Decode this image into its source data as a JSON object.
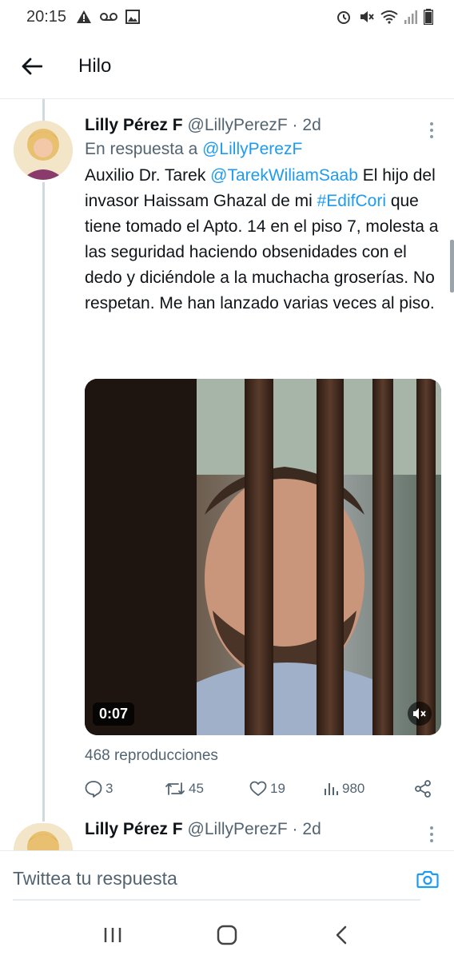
{
  "status_bar": {
    "time": "20:15",
    "left_icons": [
      "warning-icon",
      "voicemail-icon",
      "image-icon"
    ],
    "right_icons": [
      "alarm-icon",
      "mute-icon",
      "wifi-icon",
      "signal-icon",
      "battery-icon"
    ]
  },
  "header": {
    "title": "Hilo",
    "back_icon": "arrow-left-icon"
  },
  "tweet": {
    "display_name": "Lilly Pérez F",
    "handle": "@LillyPerezF · 2d",
    "reply_prefix": "En respuesta a",
    "reply_handle": "@LillyPerezF",
    "text_1": "Auxilio Dr. Tarek ",
    "mention": "@TarekWiliamSaab",
    "text_2": " El hijo del invasor Haissam Ghazal de mi ",
    "hashtag": "#EdifCori",
    "text_3": " que tiene tomado el Apto. 14 en el piso 7, molesta a las seguridad haciendo obsenidades con el dedo y diciéndole a la muchacha groserías. No respetan. Me han lanzado varias veces al piso.",
    "video_time": "0:07",
    "views_text": "468 reproducciones",
    "replies": "3",
    "retweets": "45",
    "likes": "19",
    "view_count": "980"
  },
  "tweet_2": {
    "display_name": "Lilly Pérez F",
    "handle": "@LillyPerezF · 2d"
  },
  "reply_bar": {
    "placeholder": "Twittea tu respuesta"
  },
  "colors": {
    "link": "#1d9bf0",
    "text": "#0f1419",
    "muted": "#536471"
  }
}
